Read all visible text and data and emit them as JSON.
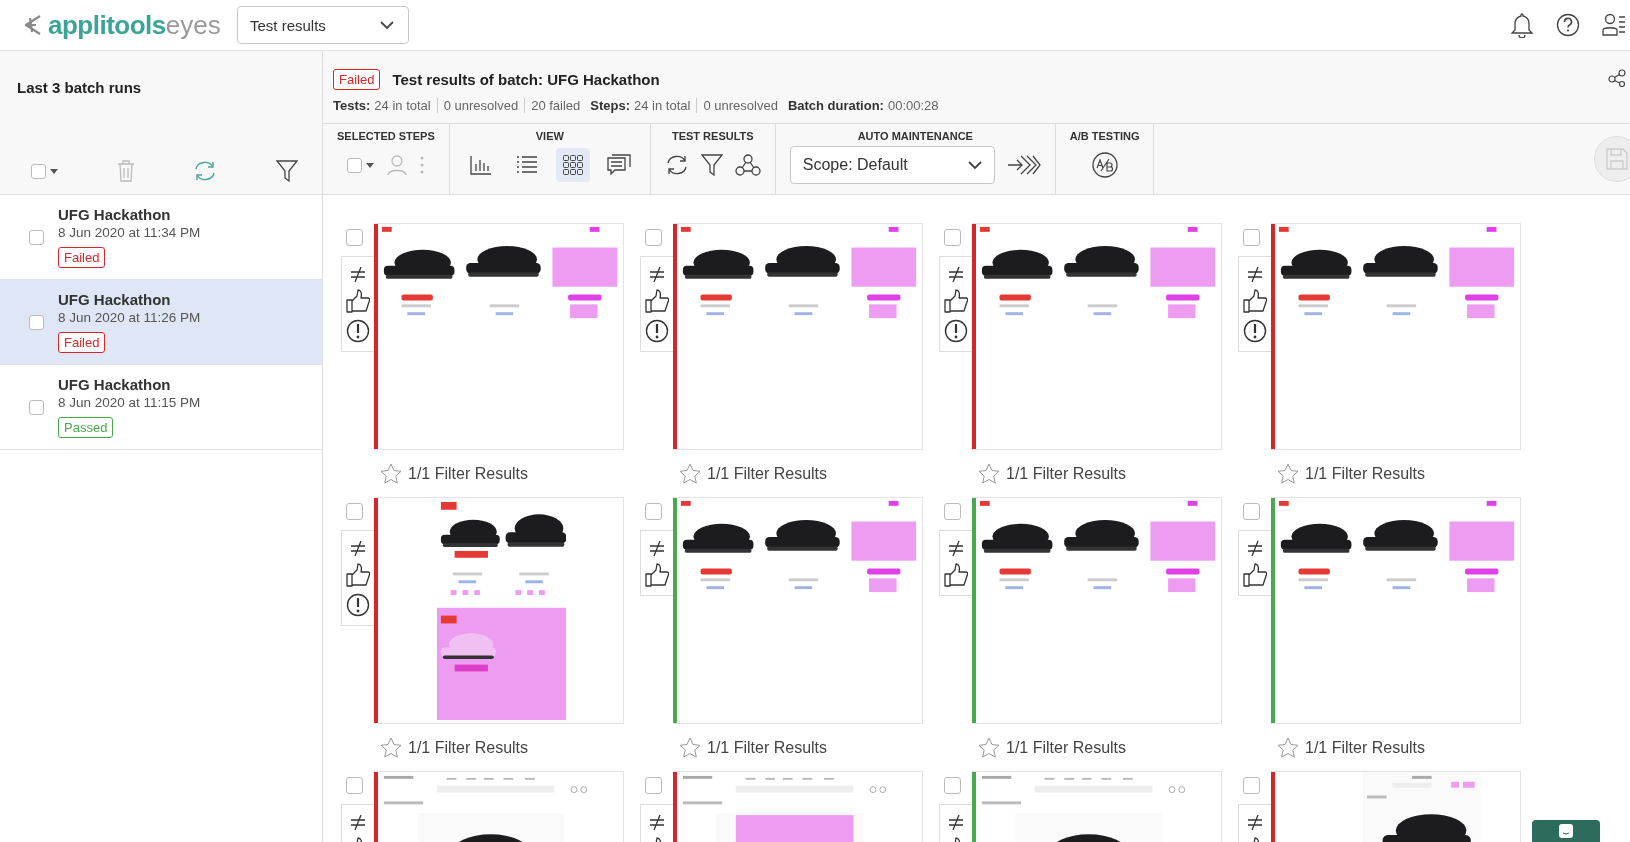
{
  "app_header": {
    "logo_brand": "applitools",
    "logo_product": "eyes",
    "page_select": "Test results"
  },
  "sidebar": {
    "title": "Last 3 batch runs",
    "select_all_checked": false,
    "batches": [
      {
        "name": "UFG Hackathon",
        "date": "8 Jun 2020 at 11:34 PM",
        "status": "Failed",
        "color": "#d7262b",
        "selected": false,
        "checked": false
      },
      {
        "name": "UFG Hackathon",
        "date": "8 Jun 2020 at 11:26 PM",
        "status": "Failed",
        "color": "#d7262b",
        "selected": true,
        "checked": false
      },
      {
        "name": "UFG Hackathon",
        "date": "8 Jun 2020 at 11:15 PM",
        "status": "Passed",
        "color": "#49a94d",
        "selected": false,
        "checked": false
      }
    ]
  },
  "batch": {
    "status": "Failed",
    "color": "#d7262b",
    "title": "Test results of batch: UFG Hackathon",
    "stats": [
      {
        "label": "Tests:",
        "values": [
          "24 in total",
          "0 unresolved",
          "20 failed"
        ]
      },
      {
        "label": "Steps:",
        "values": [
          "24 in total",
          "0 unresolved"
        ]
      },
      {
        "label": "Batch duration:",
        "values": [
          "00:00:28"
        ]
      }
    ]
  },
  "toolbar": {
    "sections": [
      {
        "kind": "steps",
        "title": "SELECTED STEPS",
        "checked": false
      },
      {
        "kind": "view",
        "title": "VIEW",
        "modes": [
          {
            "kind": "chart",
            "selected": false
          },
          {
            "kind": "list",
            "selected": false
          },
          {
            "kind": "grid",
            "selected": true
          },
          {
            "kind": "comments",
            "selected": false
          }
        ]
      },
      {
        "kind": "results",
        "title": "TEST RESULTS"
      },
      {
        "kind": "maintenance",
        "title": "AUTO MAINTENANCE",
        "scope": "Scope: Default"
      },
      {
        "kind": "ab",
        "title": "A/B TESTING"
      }
    ]
  },
  "cards": [
    {
      "color": "#d7262b",
      "kind": "row",
      "issue": true,
      "checked": false,
      "starred": false,
      "caption": "1/1 Filter Results"
    },
    {
      "color": "#d7262b",
      "kind": "row",
      "issue": true,
      "checked": false,
      "starred": false,
      "caption": "1/1 Filter Results"
    },
    {
      "color": "#d7262b",
      "kind": "row",
      "issue": true,
      "checked": false,
      "starred": false,
      "caption": "1/1 Filter Results"
    },
    {
      "color": "#d7262b",
      "kind": "row",
      "issue": true,
      "checked": false,
      "starred": false,
      "caption": "1/1 Filter Results"
    },
    {
      "color": "#d7262b",
      "kind": "stacked",
      "issue": true,
      "checked": false,
      "starred": false,
      "caption": "1/1 Filter Results"
    },
    {
      "color": "#49a94d",
      "kind": "row",
      "issue": false,
      "checked": false,
      "starred": false,
      "caption": "1/1 Filter Results"
    },
    {
      "color": "#49a94d",
      "kind": "row",
      "issue": false,
      "checked": false,
      "starred": false,
      "caption": "1/1 Filter Results"
    },
    {
      "color": "#49a94d",
      "kind": "row",
      "issue": false,
      "checked": false,
      "starred": false,
      "caption": "1/1 Filter Results"
    },
    {
      "color": "#d7262b",
      "kind": "page",
      "checked": false
    },
    {
      "color": "#d7262b",
      "kind": "pagediff",
      "checked": false
    },
    {
      "color": "#49a94d",
      "kind": "page",
      "checked": false
    },
    {
      "color": "#d7262b",
      "kind": "narrow",
      "checked": false
    }
  ]
}
